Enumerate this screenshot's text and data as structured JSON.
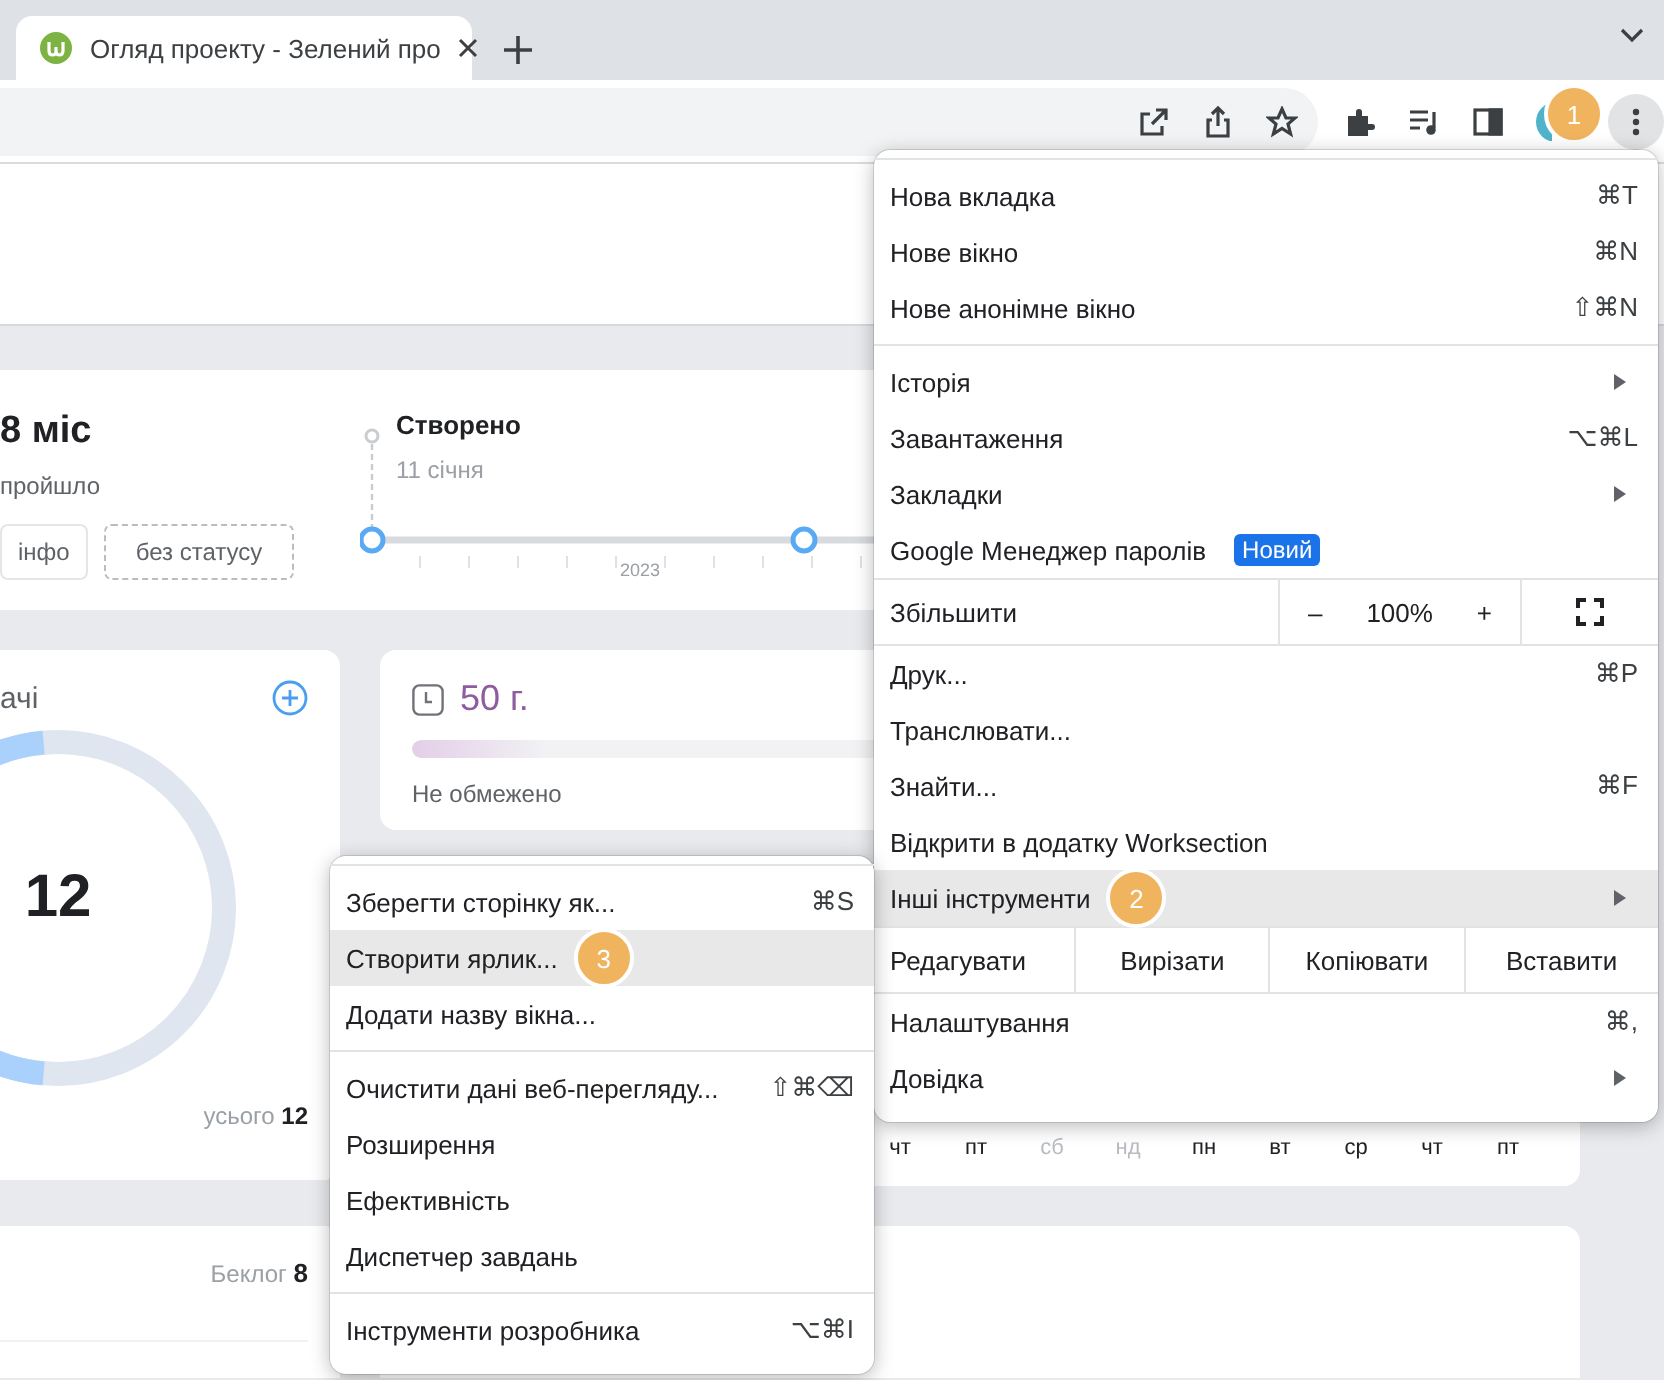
{
  "tab": {
    "title": "Огляд проекту - Зелений про"
  },
  "toolbar": {
    "callout": "1"
  },
  "summary": {
    "duration": "8 міс",
    "duration_caption": "пройшло",
    "buttons": [
      {
        "label": "інфо",
        "kind": "solid"
      },
      {
        "label": "без статусу",
        "kind": "dashed"
      }
    ],
    "milestone": {
      "title": "Створено",
      "date": "11 січня"
    },
    "year": "2023"
  },
  "tasks": {
    "title": "ачі",
    "count": "12",
    "total_label": "усього",
    "total": "12"
  },
  "time": {
    "value": "50 г.",
    "limit": "Не обмежено",
    "level": 0.12
  },
  "calendar": {
    "days": [
      {
        "label": "чт",
        "weekend": false
      },
      {
        "label": "пт",
        "weekend": false
      },
      {
        "label": "сб",
        "weekend": true
      },
      {
        "label": "нд",
        "weekend": true
      },
      {
        "label": "пн",
        "weekend": false
      },
      {
        "label": "вт",
        "weekend": false
      },
      {
        "label": "ср",
        "weekend": false
      },
      {
        "label": "чт",
        "weekend": false
      },
      {
        "label": "пт",
        "weekend": false
      }
    ]
  },
  "backlog": {
    "label": "Беклог",
    "count": "8"
  },
  "main_menu": {
    "sections": [
      {
        "items": [
          {
            "kind": "item",
            "label": "Нова вкладка",
            "shortcut": "⌘T",
            "has_submenu": false,
            "highlighted": false
          },
          {
            "kind": "item",
            "label": "Нове вікно",
            "shortcut": "⌘N",
            "has_submenu": false,
            "highlighted": false
          },
          {
            "kind": "item",
            "label": "Нове анонімне вікно",
            "shortcut": "⇧⌘N",
            "has_submenu": false,
            "highlighted": false
          }
        ]
      },
      {
        "items": [
          {
            "kind": "item",
            "label": "Історія",
            "has_submenu": true,
            "highlighted": false
          },
          {
            "kind": "item",
            "label": "Завантаження",
            "shortcut": "⌥⌘L",
            "has_submenu": false,
            "highlighted": false
          },
          {
            "kind": "item",
            "label": "Закладки",
            "has_submenu": true,
            "highlighted": false
          },
          {
            "kind": "item",
            "label": "Google Менеджер паролів",
            "badge": "Новий",
            "has_submenu": false,
            "highlighted": false
          }
        ]
      },
      {
        "items": [
          {
            "kind": "zoom",
            "label": "Збільшити",
            "minus": "–",
            "value": "100%",
            "plus": "+"
          }
        ]
      },
      {
        "items": [
          {
            "kind": "item",
            "label": "Друк...",
            "shortcut": "⌘P",
            "has_submenu": false,
            "highlighted": false
          },
          {
            "kind": "item",
            "label": "Транслювати...",
            "has_submenu": false,
            "highlighted": false
          },
          {
            "kind": "item",
            "label": "Знайти...",
            "shortcut": "⌘F",
            "has_submenu": false,
            "highlighted": false
          },
          {
            "kind": "item",
            "label": "Відкрити в додатку Worksection",
            "has_submenu": false,
            "highlighted": false
          },
          {
            "kind": "item",
            "label": "Інші інструменти",
            "callout": "2",
            "has_submenu": true,
            "highlighted": true
          }
        ]
      },
      {
        "items": [
          {
            "kind": "edit",
            "label": "Редагувати",
            "actions": [
              "Вирізати",
              "Копіювати",
              "Вставити"
            ]
          }
        ]
      },
      {
        "items": [
          {
            "kind": "item",
            "label": "Налаштування",
            "shortcut": "⌘,",
            "has_submenu": false,
            "highlighted": false
          },
          {
            "kind": "item",
            "label": "Довідка",
            "has_submenu": true,
            "highlighted": false
          }
        ]
      }
    ]
  },
  "submenu": {
    "sections": [
      {
        "items": [
          {
            "kind": "item",
            "label": "Зберегти сторінку як...",
            "shortcut": "⌘S",
            "has_submenu": false,
            "highlighted": false
          },
          {
            "kind": "item",
            "label": "Створити ярлик...",
            "callout": "3",
            "has_submenu": false,
            "highlighted": true
          },
          {
            "kind": "item",
            "label": "Додати назву вікна...",
            "has_submenu": false,
            "highlighted": false
          }
        ]
      },
      {
        "items": [
          {
            "kind": "item",
            "label": "Очистити дані веб-перегляду...",
            "shortcut": "⇧⌘⌫",
            "has_submenu": false,
            "highlighted": false
          },
          {
            "kind": "item",
            "label": "Розширення",
            "has_submenu": false,
            "highlighted": false
          },
          {
            "kind": "item",
            "label": "Ефективність",
            "has_submenu": false,
            "highlighted": false
          },
          {
            "kind": "item",
            "label": "Диспетчер завдань",
            "has_submenu": false,
            "highlighted": false
          }
        ]
      },
      {
        "items": [
          {
            "kind": "item",
            "label": "Інструменти розробника",
            "shortcut": "⌥⌘I",
            "has_submenu": false,
            "highlighted": false
          }
        ]
      }
    ]
  }
}
